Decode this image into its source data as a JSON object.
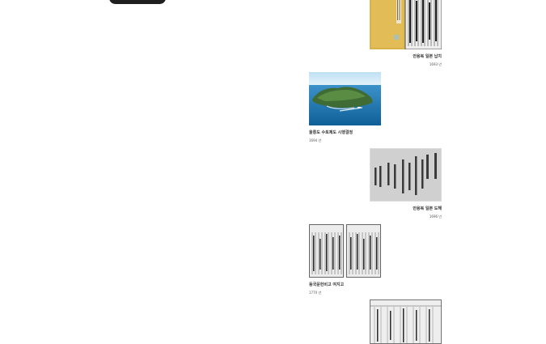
{
  "items": [
    {
      "title": "안용복 일본 납치",
      "year": "1693 년",
      "image": "yellow-bound-book-pages"
    },
    {
      "title": "울릉도 수토제도 시행결정",
      "year": "1694 년",
      "image": "ulleungdo-aerial-photo"
    },
    {
      "title": "안용복 일본 도해",
      "year": "1696 년",
      "image": "handwritten-document"
    },
    {
      "title": "동국문헌비고 여지고",
      "year": "1770 년",
      "image": "open-printed-book"
    },
    {
      "title": "",
      "year": "",
      "image": "printed-document"
    }
  ]
}
